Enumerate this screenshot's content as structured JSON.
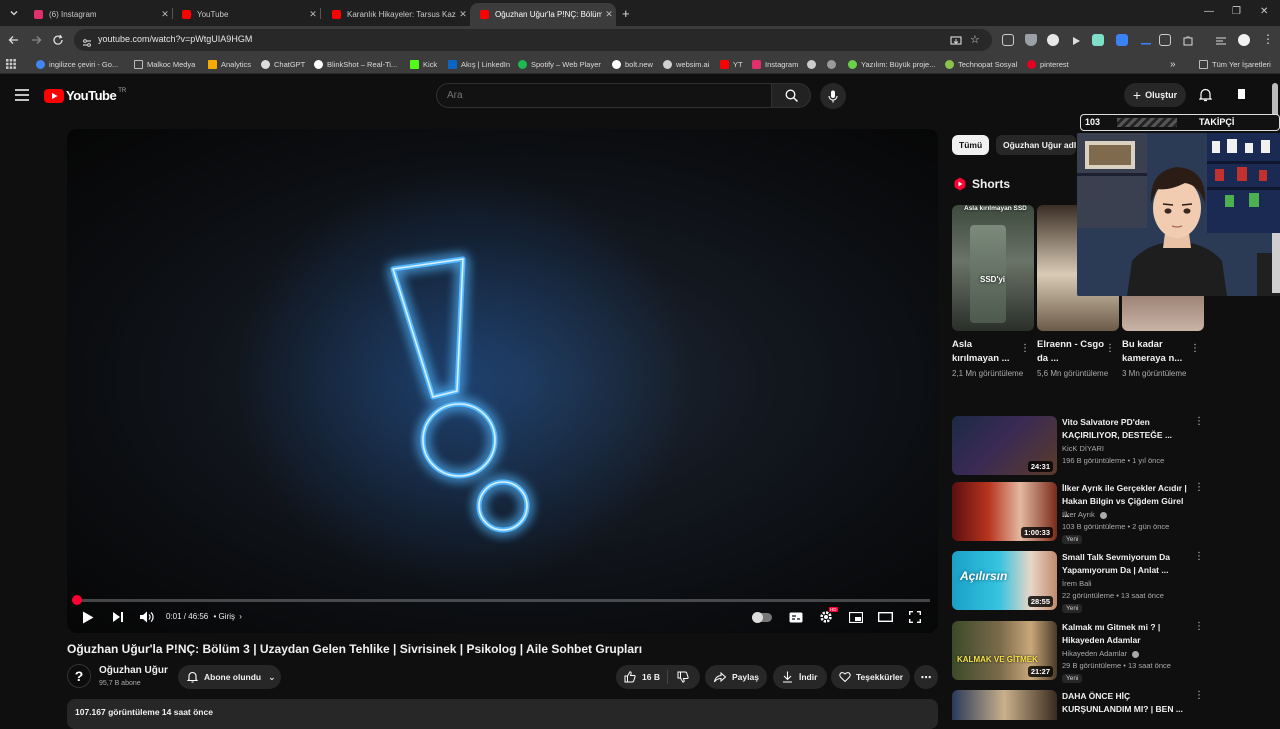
{
  "browser": {
    "tabs": [
      {
        "title": "(6) Instagram",
        "color": "#e1306c",
        "active": false
      },
      {
        "title": "YouTube",
        "color": "#ff0000",
        "active": false
      },
      {
        "title": "Karanlık Hikayeler: Tarsus Kazısı",
        "color": "#ff0000",
        "active": false
      },
      {
        "title": "Oğuzhan Uğur'la P!NÇ: Bölüm",
        "color": "#ff0000",
        "active": true
      }
    ],
    "new_tab": "+",
    "url": "youtube.com/watch?v=pWtgUIA9HGM",
    "bookmarks": [
      {
        "label": "ingilizce çeviri - Go...",
        "color": "#4285f4"
      },
      {
        "label": "Malkoc Medya",
        "color": "#bbbbbb"
      },
      {
        "label": "Analytics",
        "color": "#f9ab00"
      },
      {
        "label": "ChatGPT",
        "color": "#dddddd"
      },
      {
        "label": "BlinkShot – Real-Ti...",
        "color": "#ffffff"
      },
      {
        "label": "Kick",
        "color": "#53fc18"
      },
      {
        "label": "Akış | LinkedIn",
        "color": "#0a66c2"
      },
      {
        "label": "Spotify – Web Player",
        "color": "#1db954"
      },
      {
        "label": "bolt.new",
        "color": "#ffffff"
      },
      {
        "label": "websim.ai",
        "color": "#cfcfcf"
      },
      {
        "label": "YT",
        "color": "#ff0000"
      },
      {
        "label": "Instagram",
        "color": "#e1306c"
      },
      {
        "label": "Yazılım: Büyük proje...",
        "color": "#6bd14b"
      },
      {
        "label": "Technopat Sosyal",
        "color": "#8bc34a"
      },
      {
        "label": "pinterest",
        "color": "#e60023"
      }
    ],
    "all_bookmarks": "Tüm Yer İşaretleri"
  },
  "youtube": {
    "logo_text": "YouTube",
    "logo_region": "TR",
    "search_placeholder": "Ara",
    "create_label": "Oluştur"
  },
  "video": {
    "title": "Oğuzhan Uğur'la P!NÇ: Bölüm 3 | Uzaydan Gelen Tehlike | Sivrisinek | Psikolog | Aile Sohbet Grupları",
    "time": "0:01 / 46:56",
    "chapter": "Giriş",
    "progress_fraction": 0.0004,
    "channel": "Oğuzhan Uğur",
    "subscribers": "95,7 B abone",
    "subscribed_label": "Abone olundu",
    "likes": "16 B",
    "share_label": "Paylaş",
    "download_label": "İndir",
    "thanks_label": "Teşekkürler",
    "views_line": "107.167 görüntüleme  14 saat önce"
  },
  "sidebar": {
    "chips": [
      "Tümü",
      "Oğuzhan Uğur adlı"
    ],
    "shorts_title": "Shorts",
    "shorts": [
      {
        "title": "Asla kırılmayan ...",
        "views": "2,1 Mn görüntüleme",
        "overlay_top": "Asla kırılmayan SSD",
        "overlay_mid": "SSD'yi"
      },
      {
        "title": "Elraenn - Csgo da ...",
        "views": "5,6 Mn görüntüleme",
        "overlay_top": "",
        "overlay_mid": ""
      },
      {
        "title": "Bu kadar kameraya n...",
        "views": "3 Mn görüntüleme",
        "overlay_top": "",
        "overlay_mid": ""
      }
    ],
    "recommendations": [
      {
        "title": "Vito Salvatore PD'den KAÇIRILIYOR, DESTEĞE ...",
        "channel": "KicK DİYARI",
        "meta": "196 B görüntüleme • 1 yıl önce",
        "duration": "24:31",
        "is_new": false,
        "verified": false
      },
      {
        "title": "İlker Ayrık ile Gerçekler Acıdır | Hakan Bilgin vs Çiğdem Gürel ...",
        "channel": "İlker Ayrık",
        "meta": "103 B görüntüleme • 2 gün önce",
        "duration": "1:00:33",
        "is_new": true,
        "verified": true
      },
      {
        "title": "Small Talk Sevmiyorum Da Yapamıyorum Da | Anlat ...",
        "channel": "İrem Bali",
        "meta": "22 görüntüleme • 13 saat önce",
        "duration": "28:55",
        "is_new": true,
        "verified": false
      },
      {
        "title": "Kalmak mı Gitmek mi ? | Hikayeden Adamlar",
        "channel": "Hikayeden Adamlar",
        "meta": "29 B görüntüleme • 13 saat önce",
        "duration": "21:27",
        "is_new": true,
        "verified": true
      },
      {
        "title": "DAHA ÖNCE HİÇ KURŞUNLANDIM MI? | BEN ...",
        "channel": "",
        "meta": "",
        "duration": "",
        "is_new": false,
        "verified": false
      }
    ],
    "new_badge": "Yeni",
    "rec_thumb_texts": [
      "",
      "",
      "Açılırsın",
      "KALMAK VE GİTMEK",
      ""
    ]
  },
  "overlay": {
    "followers_count": "103",
    "followers_label": "TAKİPÇİ"
  },
  "icons": {
    "back": "arrow-left-icon",
    "forward": "arrow-right-icon",
    "reload": "reload-icon",
    "menu": "hamburger-icon",
    "search": "search-icon",
    "mic": "mic-icon",
    "bell": "bell-icon",
    "play": "play-icon",
    "next": "next-icon",
    "volume": "volume-icon",
    "settings": "gear-icon",
    "fullscreen": "fullscreen-icon"
  },
  "colors": {
    "youtube_red": "#ff0000",
    "progress_red": "#ff0033",
    "neon_blue": "#3fa9ff",
    "background": "#0f0f0f"
  }
}
